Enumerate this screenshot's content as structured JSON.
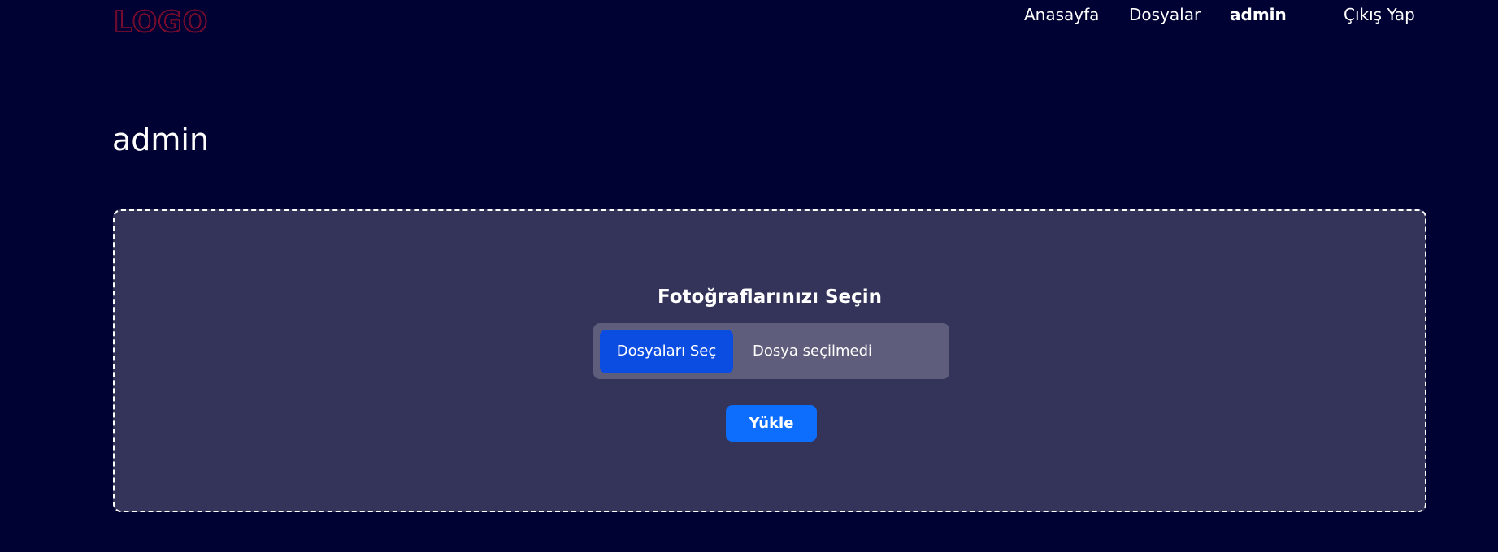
{
  "brand": {
    "logo_text": "LOGO",
    "logo_color": "#d0142a"
  },
  "nav": {
    "home": "Anasayfa",
    "files": "Dosyalar",
    "user": "admin",
    "logout": "Çıkış Yap"
  },
  "page": {
    "title": "admin"
  },
  "upload": {
    "heading": "Fotoğraflarınızı Seçin",
    "choose_label": "Dosyaları Seç",
    "no_file_text": "Dosya seçilmedi",
    "submit_label": "Yükle"
  },
  "colors": {
    "background": "#000233",
    "panel": "#34345b",
    "file_input_bg": "#5e5e7c",
    "choose_button": "#0b4de0",
    "submit_button": "#0d6efd"
  }
}
